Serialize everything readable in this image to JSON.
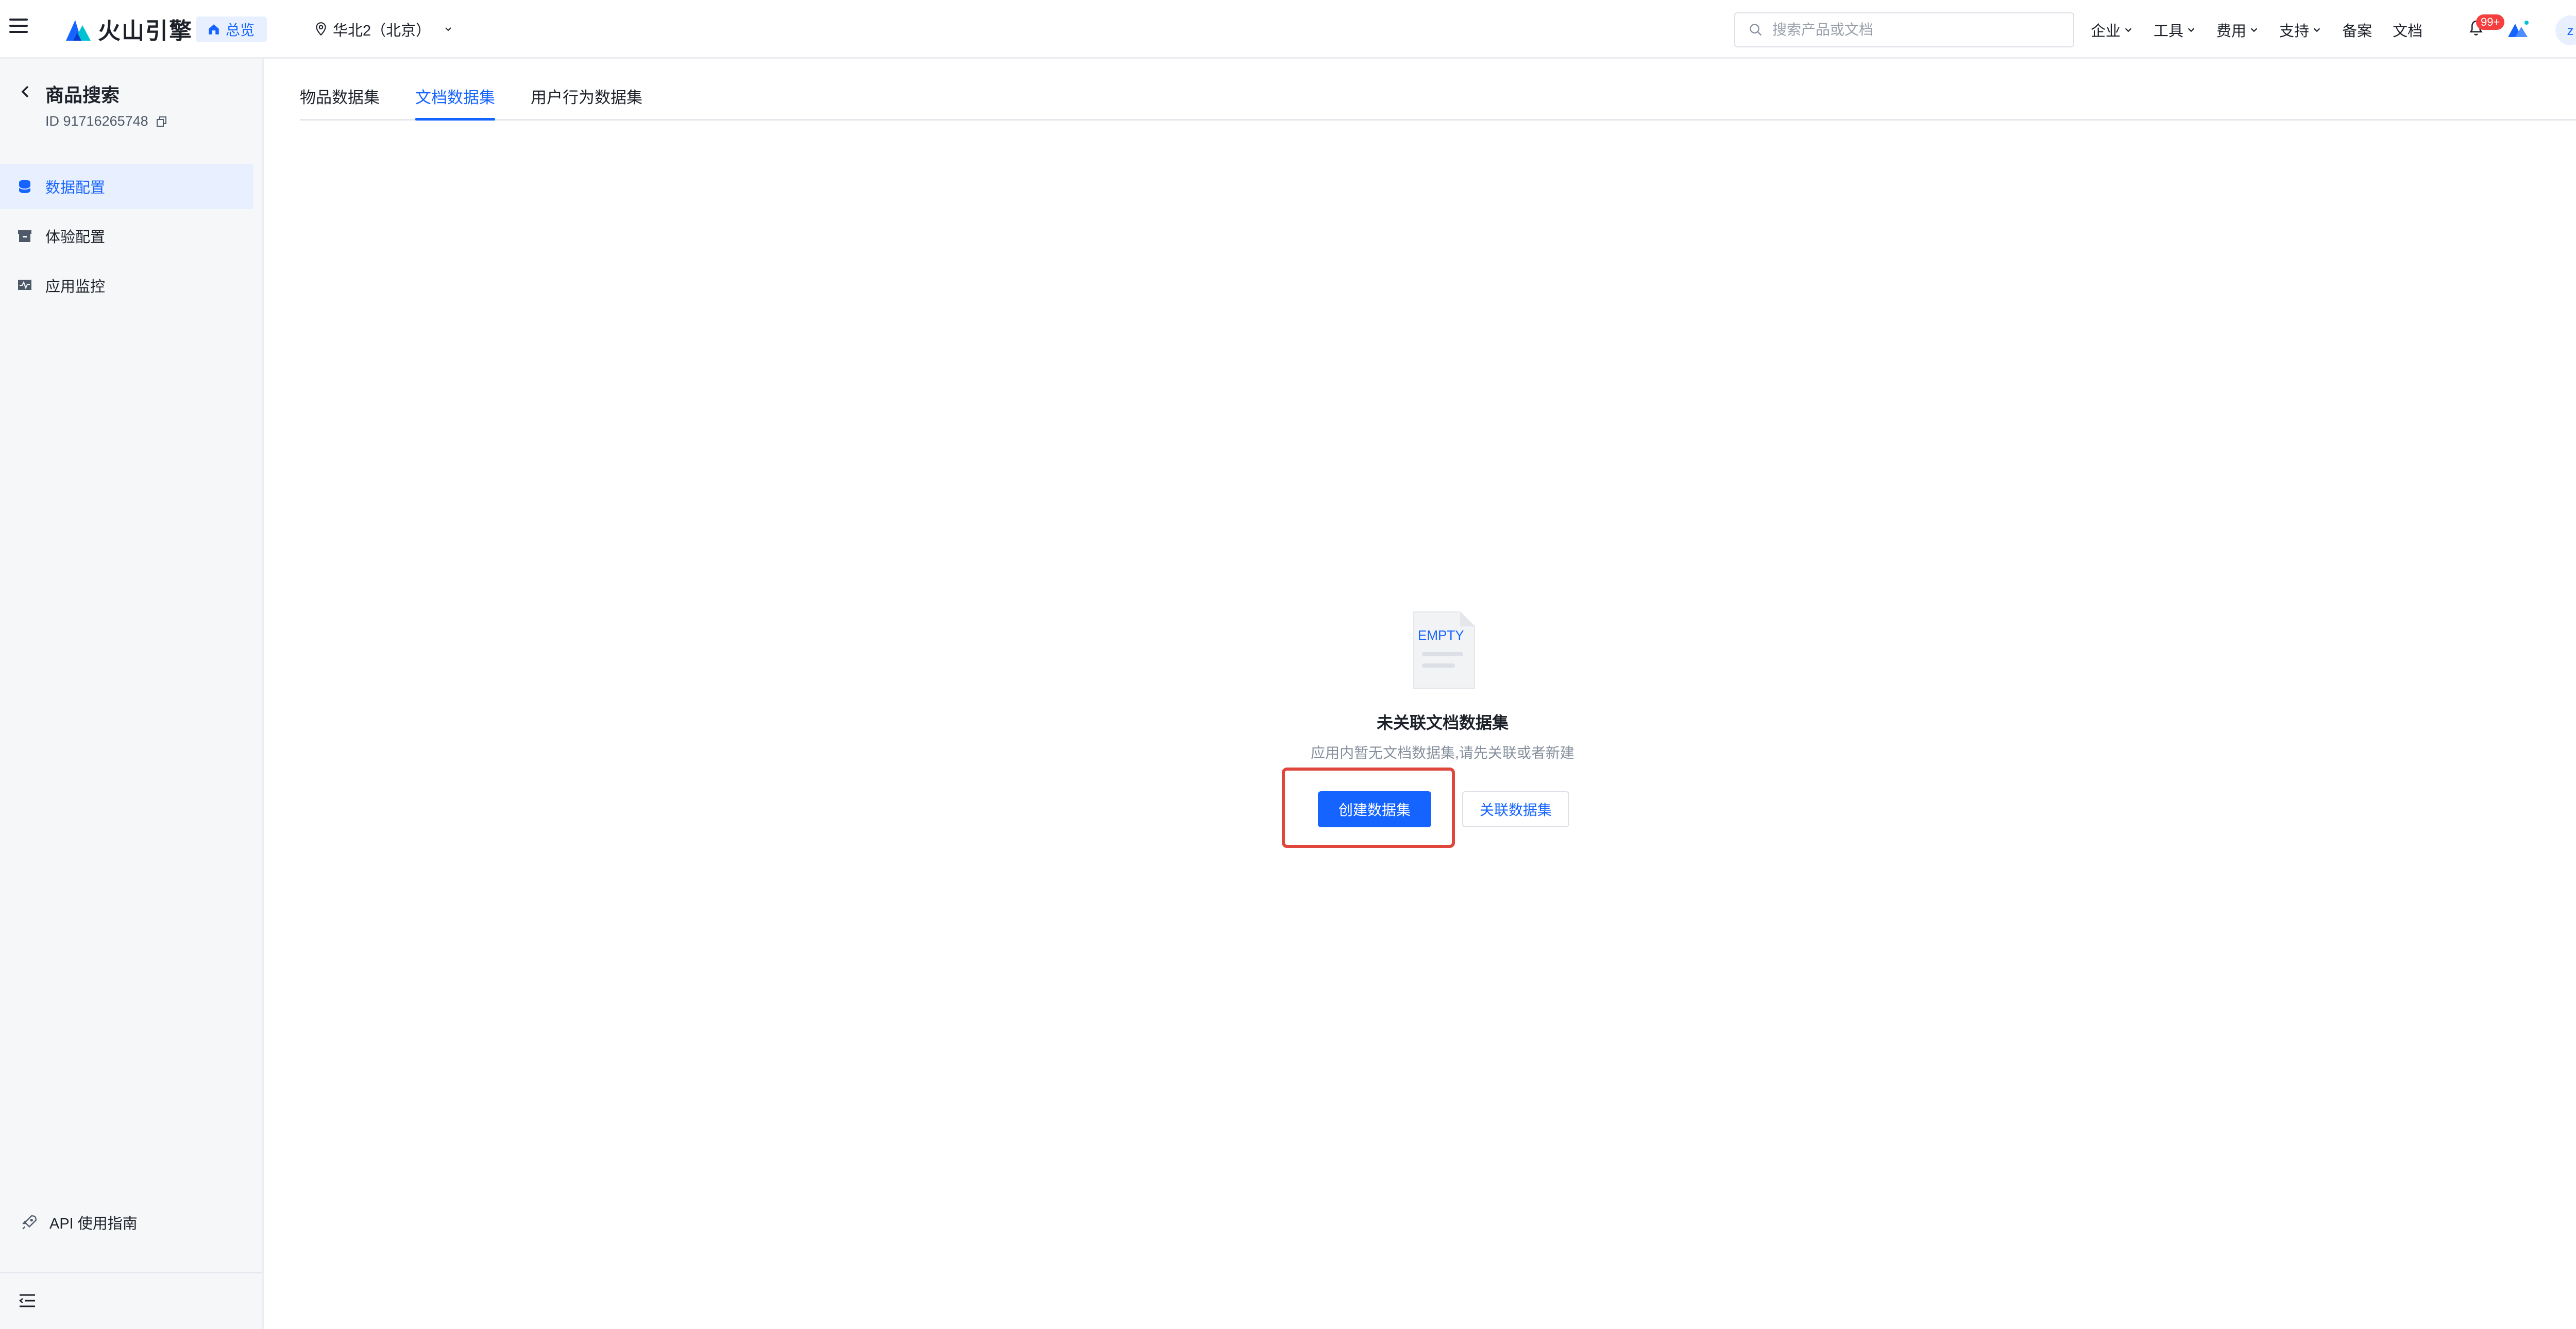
{
  "header": {
    "logo_text": "火山引擎",
    "home_label": "总览",
    "region": "华北2（北京）",
    "search_placeholder": "搜索产品或文档",
    "nav": [
      {
        "label": "企业"
      },
      {
        "label": "工具"
      },
      {
        "label": "费用"
      },
      {
        "label": "支持"
      },
      {
        "label": "备案"
      },
      {
        "label": "文档"
      }
    ],
    "notification_count": "99+",
    "avatar_letter": "z"
  },
  "sidebar": {
    "app_title": "商品搜索",
    "app_id": "ID 91716265748",
    "items": [
      {
        "label": "数据配置",
        "active": true
      },
      {
        "label": "体验配置",
        "active": false
      },
      {
        "label": "应用监控",
        "active": false
      }
    ],
    "api_guide": "API 使用指南"
  },
  "tabs": [
    {
      "label": "物品数据集",
      "active": false
    },
    {
      "label": "文档数据集",
      "active": true
    },
    {
      "label": "用户行为数据集",
      "active": false
    }
  ],
  "empty": {
    "illustration_text": "EMPTY",
    "title": "未关联文档数据集",
    "description": "应用内暂无文档数据集,请先关联或者新建",
    "create_button": "创建数据集",
    "link_button": "关联数据集"
  },
  "colors": {
    "accent": "#1664ff",
    "highlight_border": "#e0463b",
    "badge": "#f53f3f"
  }
}
